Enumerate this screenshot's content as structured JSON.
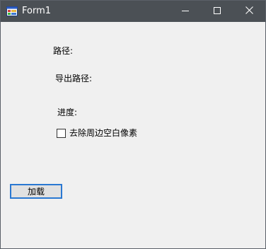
{
  "window": {
    "title": "Form1",
    "app_icon": "form-app-icon",
    "controls": {
      "minimize_icon": "minimize-icon",
      "maximize_icon": "maximize-icon",
      "close_icon": "close-icon"
    }
  },
  "form": {
    "path_label": "路径:",
    "export_path_label": "导出路径:",
    "progress_label": "进度:",
    "trim_checkbox": {
      "label": "去除周边空白像素",
      "checked": false
    },
    "load_button_label": "加载"
  },
  "colors": {
    "titlebar": "#4b5055",
    "window_bg": "#f0f0f0",
    "button_focus_border": "#2a78d2"
  }
}
